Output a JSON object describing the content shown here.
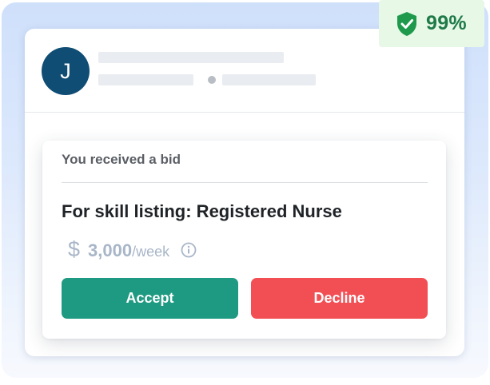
{
  "trust_badge": {
    "icon": "shield-check-icon",
    "value": "99%",
    "color": "#1f7a48",
    "background": "#e7f8e6"
  },
  "sender": {
    "avatar_initial": "J",
    "avatar_color": "#0f4d74"
  },
  "bid": {
    "heading": "You received a bid",
    "listing_title": "For skill listing: Registered Nurse",
    "currency_symbol": "$",
    "amount": "3,000",
    "unit": "/week",
    "info_icon": "info-circle-icon"
  },
  "actions": {
    "accept_label": "Accept",
    "accept_color": "#1f9a82",
    "decline_label": "Decline",
    "decline_color": "#f24f55"
  }
}
